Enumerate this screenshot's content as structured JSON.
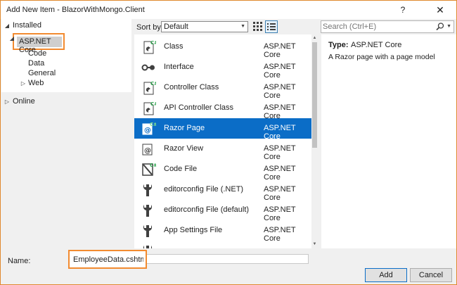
{
  "window": {
    "title": "Add New Item - BlazorWithMongo.Client",
    "help_label": "?",
    "close_label": "✕"
  },
  "tree": {
    "installed": "Installed",
    "asp_net_core": "ASP.NET Core",
    "children": [
      "Code",
      "Data",
      "General",
      "Web"
    ],
    "online": "Online"
  },
  "toolbar": {
    "sort_label": "Sort by:",
    "sort_value": "Default",
    "search_placeholder": "Search (Ctrl+E)"
  },
  "items": [
    {
      "name": "Class",
      "category": "ASP.NET Core",
      "icon": "class-icon"
    },
    {
      "name": "Interface",
      "category": "ASP.NET Core",
      "icon": "interface-icon"
    },
    {
      "name": "Controller Class",
      "category": "ASP.NET Core",
      "icon": "controller-class-icon"
    },
    {
      "name": "API Controller Class",
      "category": "ASP.NET Core",
      "icon": "api-controller-icon"
    },
    {
      "name": "Razor Page",
      "category": "ASP.NET Core",
      "icon": "razor-page-icon"
    },
    {
      "name": "Razor View",
      "category": "ASP.NET Core",
      "icon": "razor-view-icon"
    },
    {
      "name": "Code File",
      "category": "ASP.NET Core",
      "icon": "code-file-icon"
    },
    {
      "name": "editorconfig File (.NET)",
      "category": "ASP.NET Core",
      "icon": "wrench-icon"
    },
    {
      "name": "editorconfig File (default)",
      "category": "ASP.NET Core",
      "icon": "wrench-icon"
    },
    {
      "name": "App Settings File",
      "category": "ASP.NET Core",
      "icon": "wrench-icon"
    },
    {
      "name": "",
      "category": "",
      "icon": "wrench-icon"
    }
  ],
  "details": {
    "type_key": "Type:",
    "type_value": "ASP.NET Core",
    "description": "A Razor page with a page model"
  },
  "bottom": {
    "name_label": "Name:",
    "name_value": "EmployeeData.cshtml",
    "add_label": "Add",
    "cancel_label": "Cancel"
  },
  "colors": {
    "accent": "#0b6dc7",
    "highlight_border": "#f28b30",
    "icon_green": "#2ea44f"
  }
}
